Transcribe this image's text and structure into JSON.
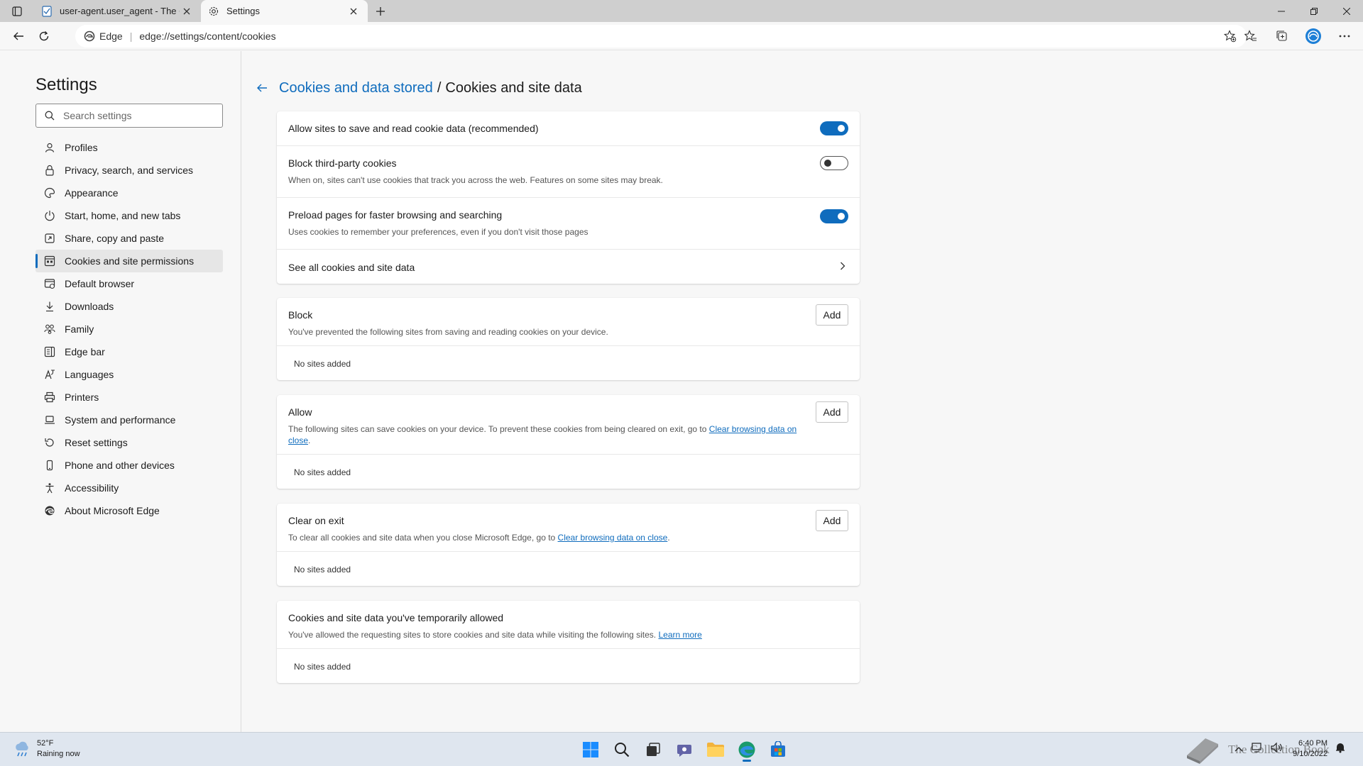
{
  "tabs": [
    {
      "title": "user-agent.user_agent - The Coll",
      "active": false,
      "favicon": "page-icon"
    },
    {
      "title": "Settings",
      "active": true,
      "favicon": "gear-icon"
    }
  ],
  "toolbar": {
    "address_brand": "Edge",
    "address_url": "edge://settings/content/cookies"
  },
  "sidebar": {
    "title": "Settings",
    "search_placeholder": "Search settings",
    "items": [
      {
        "label": "Profiles",
        "icon": "profile-icon"
      },
      {
        "label": "Privacy, search, and services",
        "icon": "lock-icon"
      },
      {
        "label": "Appearance",
        "icon": "appearance-icon"
      },
      {
        "label": "Start, home, and new tabs",
        "icon": "power-icon"
      },
      {
        "label": "Share, copy and paste",
        "icon": "share-icon"
      },
      {
        "label": "Cookies and site permissions",
        "icon": "cookie-permissions-icon",
        "selected": true
      },
      {
        "label": "Default browser",
        "icon": "default-browser-icon"
      },
      {
        "label": "Downloads",
        "icon": "download-icon"
      },
      {
        "label": "Family",
        "icon": "family-icon"
      },
      {
        "label": "Edge bar",
        "icon": "edge-bar-icon"
      },
      {
        "label": "Languages",
        "icon": "languages-icon"
      },
      {
        "label": "Printers",
        "icon": "printer-icon"
      },
      {
        "label": "System and performance",
        "icon": "laptop-icon"
      },
      {
        "label": "Reset settings",
        "icon": "reset-icon"
      },
      {
        "label": "Phone and other devices",
        "icon": "phone-icon"
      },
      {
        "label": "Accessibility",
        "icon": "accessibility-icon"
      },
      {
        "label": "About Microsoft Edge",
        "icon": "edge-logo-icon"
      }
    ]
  },
  "breadcrumb": {
    "parent": "Cookies and data stored",
    "separator": "/",
    "current": "Cookies and site data"
  },
  "settings": {
    "allow_cookies": {
      "label": "Allow sites to save and read cookie data (recommended)",
      "enabled": true
    },
    "block_third_party": {
      "label": "Block third-party cookies",
      "description": "When on, sites can't use cookies that track you across the web. Features on some sites may break.",
      "enabled": false
    },
    "preload": {
      "label": "Preload pages for faster browsing and searching",
      "description": "Uses cookies to remember your preferences, even if you don't visit those pages",
      "enabled": true
    },
    "see_all": {
      "label": "See all cookies and site data"
    }
  },
  "sections": {
    "block": {
      "title": "Block",
      "description": "You've prevented the following sites from saving and reading cookies on your device.",
      "add_label": "Add",
      "empty": "No sites added"
    },
    "allow": {
      "title": "Allow",
      "description": "The following sites can save cookies on your device. To prevent these cookies from being cleared on exit, go to ",
      "link": "Clear browsing data on close",
      "suffix": ".",
      "add_label": "Add",
      "empty": "No sites added"
    },
    "clear_on_exit": {
      "title": "Clear on exit",
      "description": "To clear all cookies and site data when you close Microsoft Edge, go to ",
      "link": "Clear browsing data on close",
      "suffix": ".",
      "add_label": "Add",
      "empty": "No sites added"
    },
    "temporarily_allowed": {
      "title": "Cookies and site data you've temporarily allowed",
      "description": "You've allowed the requesting sites to store cookies and site data while visiting the following sites. ",
      "link": "Learn more",
      "empty": "No sites added"
    }
  },
  "taskbar": {
    "weather_temp": "52°F",
    "weather_desc": "Raining now",
    "time": "6:40 PM",
    "date": "9/10/2022",
    "watermark": "The Collection Book"
  },
  "colors": {
    "accent": "#0f6cbd",
    "page_bg": "#f7f7f7",
    "tabstrip_bg": "#cfcfcf",
    "taskbar_bg": "#dfe6ef"
  }
}
